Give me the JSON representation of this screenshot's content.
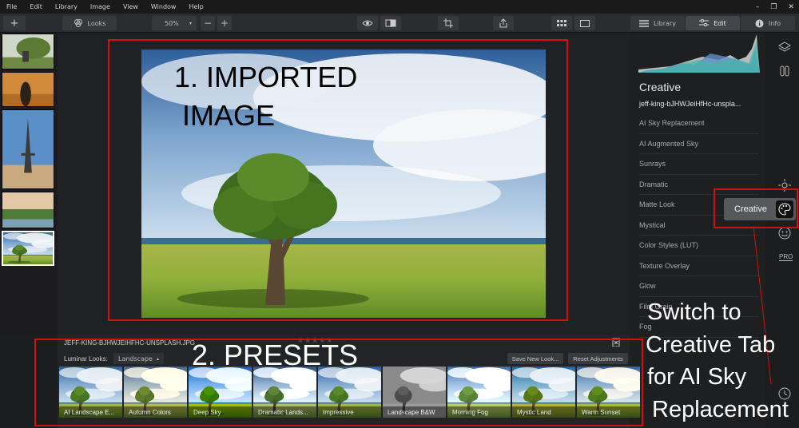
{
  "menu": [
    "File",
    "Edit",
    "Library",
    "Image",
    "View",
    "Window",
    "Help"
  ],
  "toolbar": {
    "looks_label": "Looks",
    "zoom_value": "50%",
    "tab_library": "Library",
    "tab_edit": "Edit",
    "tab_info": "Info"
  },
  "filmstrip": {
    "thumbnails": [
      "thumb-1",
      "thumb-2",
      "thumb-3",
      "thumb-4",
      "thumb-5"
    ]
  },
  "annotations": {
    "imported_line1": "1. IMPORTED",
    "imported_line2": "IMAGE",
    "presets": "2. PRESETS",
    "switch_line1": "Switch to",
    "switch_line2": "Creative Tab",
    "switch_line3": "for AI Sky",
    "switch_line4": "Replacement"
  },
  "right_panel": {
    "title": "Creative",
    "file_name": "jeff-king-bJHWJeiHfHc-unspla...",
    "tools": [
      "AI Sky Replacement",
      "AI Augmented Sky",
      "Sunrays",
      "Dramatic",
      "Matte Look",
      "Mystical",
      "Color Styles (LUT)",
      "Texture Overlay",
      "Glow",
      "Film Grain",
      "Fog"
    ]
  },
  "creative_popup": {
    "label": "Creative",
    "icon": "palette-icon"
  },
  "right_strip_icons": [
    "layers-icon",
    "adjust-icon",
    "sun-icon",
    "palette-icon",
    "face-icon",
    "pro-icon",
    "clock-icon"
  ],
  "right_strip_pro": "PRO",
  "bottom_panel": {
    "filename": "JEFF-KING-BJHWJEIHFHC-UNSPLASH.JPG",
    "looks_label": "Luminar Looks:",
    "category": "Landscape",
    "save_button": "Save New Look...",
    "reset_button": "Reset Adjustments",
    "rating_stars": "★★★★★",
    "presets": [
      "AI Landscape E...",
      "Autumn Colors",
      "Deep Sky",
      "Dramatic Lands...",
      "Impressive",
      "Landscape B&W",
      "Morning Fog",
      "Mystic Land",
      "Warm Sunset"
    ]
  },
  "colors": {
    "annotation_red": "#d40f10",
    "panel_bg": "#1e1f21",
    "popup_bg": "#57585b"
  }
}
